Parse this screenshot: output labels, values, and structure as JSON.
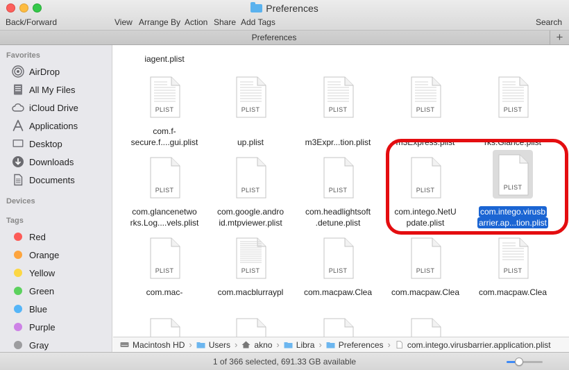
{
  "window": {
    "title": "Preferences"
  },
  "toolbar": {
    "back_forward": "Back/Forward",
    "view": "View",
    "arrange_by": "Arrange By",
    "action": "Action",
    "share": "Share",
    "add_tags": "Add Tags",
    "search": "Search"
  },
  "tab": {
    "title": "Preferences",
    "add_symbol": "+"
  },
  "sidebar": {
    "favorites_header": "Favorites",
    "favorites": [
      {
        "label": "AirDrop",
        "icon": "airdrop-icon"
      },
      {
        "label": "All My Files",
        "icon": "all-files-icon"
      },
      {
        "label": "iCloud Drive",
        "icon": "icloud-icon"
      },
      {
        "label": "Applications",
        "icon": "applications-icon"
      },
      {
        "label": "Desktop",
        "icon": "desktop-icon"
      },
      {
        "label": "Downloads",
        "icon": "downloads-icon"
      },
      {
        "label": "Documents",
        "icon": "documents-icon"
      }
    ],
    "devices_header": "Devices",
    "tags_header": "Tags",
    "tags": [
      {
        "label": "Red",
        "color": "#fc5b57"
      },
      {
        "label": "Orange",
        "color": "#fda43e"
      },
      {
        "label": "Yellow",
        "color": "#fcd744"
      },
      {
        "label": "Green",
        "color": "#5cd15e"
      },
      {
        "label": "Blue",
        "color": "#55b5f8"
      },
      {
        "label": "Purple",
        "color": "#cd82e6"
      },
      {
        "label": "Gray",
        "color": "#9c9c9f"
      }
    ]
  },
  "file_icon_label": "PLIST",
  "files": {
    "row0": [
      "iagent.plist",
      "",
      "",
      "",
      ""
    ],
    "row1": [
      {
        "line1": "com.f-",
        "line2": "secure.f....gui.plist",
        "blur1": false
      },
      {
        "line1": "",
        "line2": "up.plist",
        "blur1": true
      },
      {
        "line1": "",
        "line2": "m3Expr...tion.plist",
        "blur1": true
      },
      {
        "line1": "",
        "line2": "m3Express.plist",
        "blur1": true
      },
      {
        "line1": "",
        "line2": "rks.Glance.plist",
        "blur1": true
      }
    ],
    "row2": [
      {
        "line1": "com.glancenetwo",
        "line2": "rks.Log....vels.plist"
      },
      {
        "line1": "com.google.andro",
        "line2": "id.mtpviewer.plist"
      },
      {
        "line1": "com.headlightsoft",
        "line2": ".detune.plist"
      },
      {
        "line1": "com.intego.NetU",
        "line2": "pdate.plist"
      },
      {
        "line1": "com.intego.virusb",
        "line2": "arrier.ap...tion.plist"
      }
    ],
    "row3": [
      {
        "line1": "com.mac-",
        "line2": ""
      },
      {
        "line1": "com.macblurraypl",
        "line2": ""
      },
      {
        "line1": "com.macpaw.Clea",
        "line2": ""
      },
      {
        "line1": "com.macpaw.Clea",
        "line2": ""
      },
      {
        "line1": "com.macpaw.Clea",
        "line2": ""
      }
    ]
  },
  "pathbar": [
    {
      "label": "Macintosh HD",
      "icon": "hard-drive-icon"
    },
    {
      "label": "Users",
      "icon": "folder-icon"
    },
    {
      "label": "akno",
      "icon": "home-icon"
    },
    {
      "label": "Libra",
      "icon": "folder-icon"
    },
    {
      "label": "Preferences",
      "icon": "folder-icon"
    },
    {
      "label": "com.intego.virusbarrier.application.plist",
      "icon": "file-icon"
    }
  ],
  "status": {
    "text": "1 of 366 selected, 691.33 GB available",
    "icon_size_slider": 0.35
  },
  "colors": {
    "selection": "#1b65d3",
    "annotation": "#e40d10"
  }
}
